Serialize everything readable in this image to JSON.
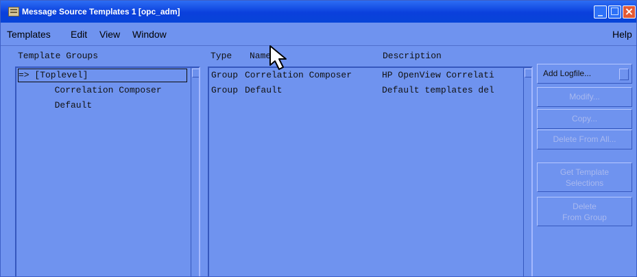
{
  "window": {
    "title": "Message Source Templates  1 [opc_adm]",
    "controls": {
      "minimize": "_",
      "maximize": "□",
      "close": "×"
    }
  },
  "menubar": {
    "templates": "Templates",
    "edit": "Edit",
    "view": "View",
    "window": "Window",
    "help": "Help"
  },
  "left_pane": {
    "label": "Template Groups",
    "items": [
      "=> [Toplevel]",
      "  Correlation Composer",
      "  Default"
    ]
  },
  "right_pane": {
    "headers": {
      "type": "Type",
      "name": "Name",
      "description": "Description"
    },
    "rows": [
      {
        "type": "Group",
        "name": "Correlation Composer",
        "description": "HP OpenView Correlati"
      },
      {
        "type": "Group",
        "name": "Default",
        "description": "Default templates del"
      }
    ]
  },
  "buttons": {
    "add_logfile": "Add Logfile...",
    "modify": "Modify...",
    "copy": "Copy...",
    "delete_from_all": "Delete From All...",
    "get_template_selections_line1": "Get Template",
    "get_template_selections_line2": "Selections",
    "delete_from_group_line1": "Delete",
    "delete_from_group_line2": "From Group"
  },
  "icons": {
    "window": "app-icon",
    "cursor": "mouse-pointer-icon",
    "dropdown": "dropdown-icon",
    "scrollbar": "scroll-thumb-icon"
  }
}
